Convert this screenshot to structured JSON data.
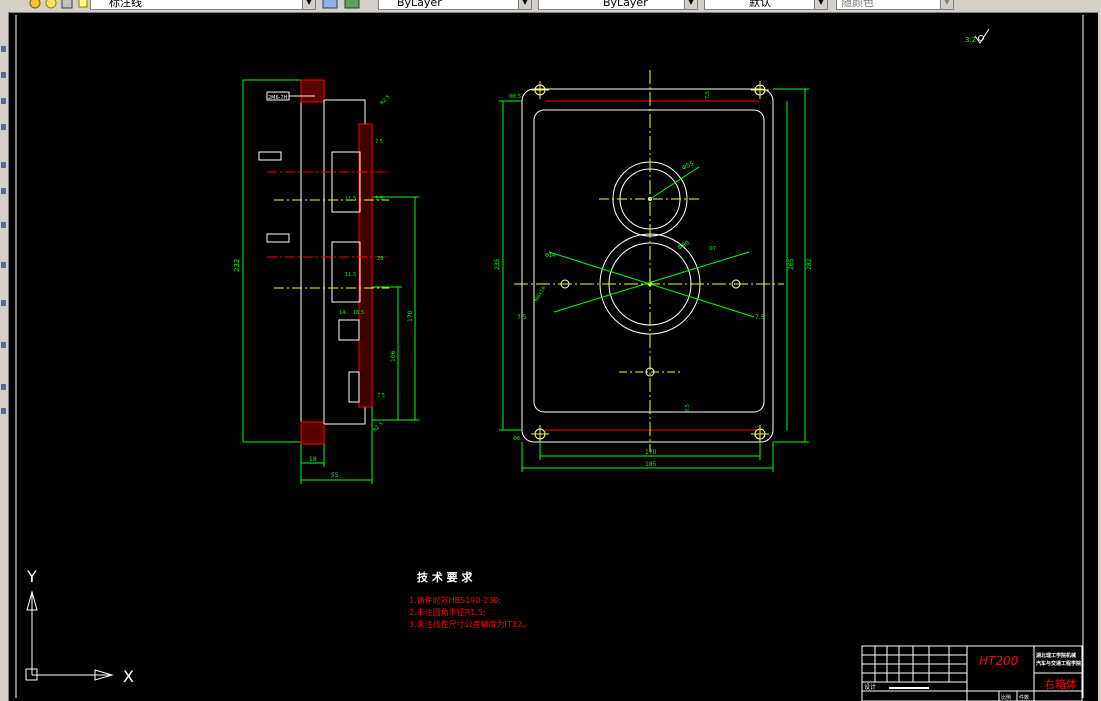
{
  "toolbar": {
    "linetype_name": "标注线",
    "color": "ByLayer",
    "linetype": "ByLayer",
    "lineweight": "默认",
    "plotstyle": "随颜色"
  },
  "drawing": {
    "roughness_symbol": "3.2",
    "side_view": {
      "total_height": "232",
      "bottom_width_1": "18",
      "bottom_width_2": "55",
      "depth_170": "170",
      "depth_106": "106",
      "note": "2M6-7H"
    },
    "front_view": {
      "height_outer": "235",
      "height_inner": "265",
      "height_right": "282",
      "width_inner": "170",
      "width_outer": "185",
      "bore_small": "Φ55",
      "bore_large": "Φ80",
      "margin_left": "7.5",
      "margin_right": "7.5"
    },
    "tech_req": {
      "title": "技 术 要 求",
      "items": [
        "1.铸件时效HBS190-230;",
        "2.未注圆角半径R1.5;",
        "3.未注线性尺寸公差精度为IT12。"
      ]
    },
    "title_block": {
      "material": "HT200",
      "school_line1": "湖北理工学院机械",
      "school_line2": "汽车与交通工程学院",
      "part_name": "右箱体",
      "label_designer": "设计",
      "label_scale": "比例",
      "label_count": "件数"
    },
    "ucs": {
      "x_label": "X",
      "y_label": "Y"
    }
  },
  "colors": {
    "outline": "#ffffff",
    "dimension": "#00ff00",
    "centerline": "#ffff00",
    "red": "#ff0000",
    "background": "#000000"
  }
}
